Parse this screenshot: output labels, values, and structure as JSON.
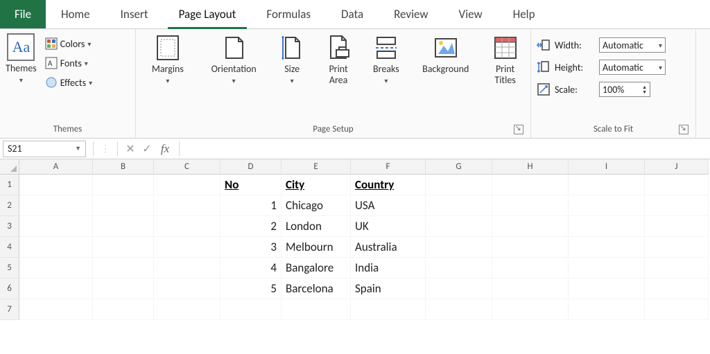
{
  "tabs": {
    "file": "File",
    "items": [
      "Home",
      "Insert",
      "Page Layout",
      "Formulas",
      "Data",
      "Review",
      "View",
      "Help"
    ],
    "active_index": 2
  },
  "ribbon": {
    "themes": {
      "label": "Themes",
      "themes_btn": "Themes",
      "colors": "Colors",
      "fonts": "Fonts",
      "effects": "Effects"
    },
    "page_setup": {
      "label": "Page Setup",
      "margins": "Margins",
      "orientation": "Orientation",
      "size": "Size",
      "print_area": "Print\nArea",
      "breaks": "Breaks",
      "background": "Background",
      "print_titles": "Print\nTitles"
    },
    "scale_to_fit": {
      "label": "Scale to Fit",
      "width_label": "Width:",
      "width_value": "Automatic",
      "height_label": "Height:",
      "height_value": "Automatic",
      "scale_label": "Scale:",
      "scale_value": "100%"
    }
  },
  "formula_bar": {
    "name_box": "S21",
    "formula": ""
  },
  "grid": {
    "columns": [
      "A",
      "B",
      "C",
      "D",
      "E",
      "F",
      "G",
      "H",
      "I",
      "J"
    ],
    "row_count": 7,
    "headers": {
      "row": 1,
      "D": "No",
      "E": "City",
      "F": "Country"
    },
    "data": [
      {
        "row": 2,
        "D": "1",
        "E": "Chicago",
        "F": "USA"
      },
      {
        "row": 3,
        "D": "2",
        "E": "London",
        "F": "UK"
      },
      {
        "row": 4,
        "D": "3",
        "E": "Melbourn",
        "F": "Australia"
      },
      {
        "row": 5,
        "D": "4",
        "E": "Bangalore",
        "F": "India"
      },
      {
        "row": 6,
        "D": "5",
        "E": "Barcelona",
        "F": "Spain"
      }
    ]
  }
}
